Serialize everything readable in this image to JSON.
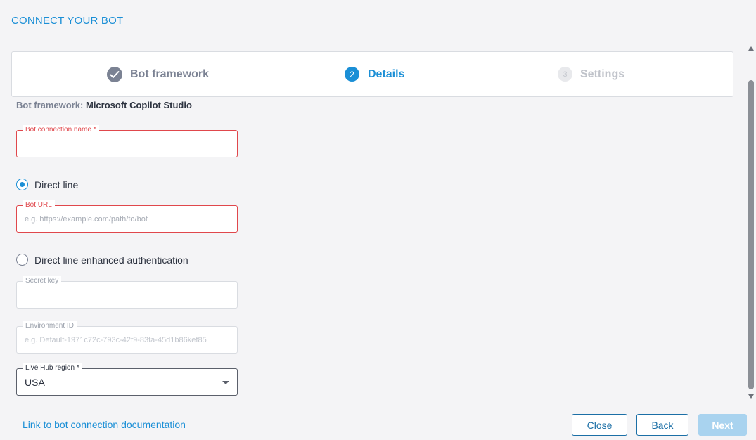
{
  "page": {
    "title": "CONNECT YOUR BOT"
  },
  "stepper": {
    "steps": [
      {
        "label": "Bot framework",
        "status": "completed",
        "icon": "check-icon"
      },
      {
        "number": "2",
        "label": "Details",
        "status": "active"
      },
      {
        "number": "3",
        "label": "Settings",
        "status": "upcoming"
      }
    ]
  },
  "framework": {
    "key": "Bot framework:",
    "value": "Microsoft Copilot Studio"
  },
  "form": {
    "connection_name": {
      "label": "Bot connection name *",
      "value": "",
      "placeholder": ""
    },
    "direct_line": {
      "label": "Direct line",
      "checked": true
    },
    "bot_url": {
      "label": "Bot URL",
      "value": "",
      "placeholder": "e.g. https://example.com/path/to/bot"
    },
    "enhanced_auth": {
      "label": "Direct line enhanced authentication",
      "checked": false
    },
    "secret_key": {
      "label": "Secret key",
      "value": "",
      "placeholder": ""
    },
    "environment_id": {
      "label": "Environment ID",
      "value": "",
      "placeholder": "e.g. Default-1971c72c-793c-42f9-83fa-45d1b86kef85"
    },
    "region": {
      "label": "Live Hub region *",
      "value": "USA"
    }
  },
  "footer": {
    "doc_link": "Link to bot connection documentation",
    "close_label": "Close",
    "back_label": "Back",
    "next_label": "Next"
  },
  "colors": {
    "accent": "#1b8fd6",
    "error": "#e0474c",
    "muted": "#7b8293",
    "next_disabled": "#a9d3ef"
  }
}
